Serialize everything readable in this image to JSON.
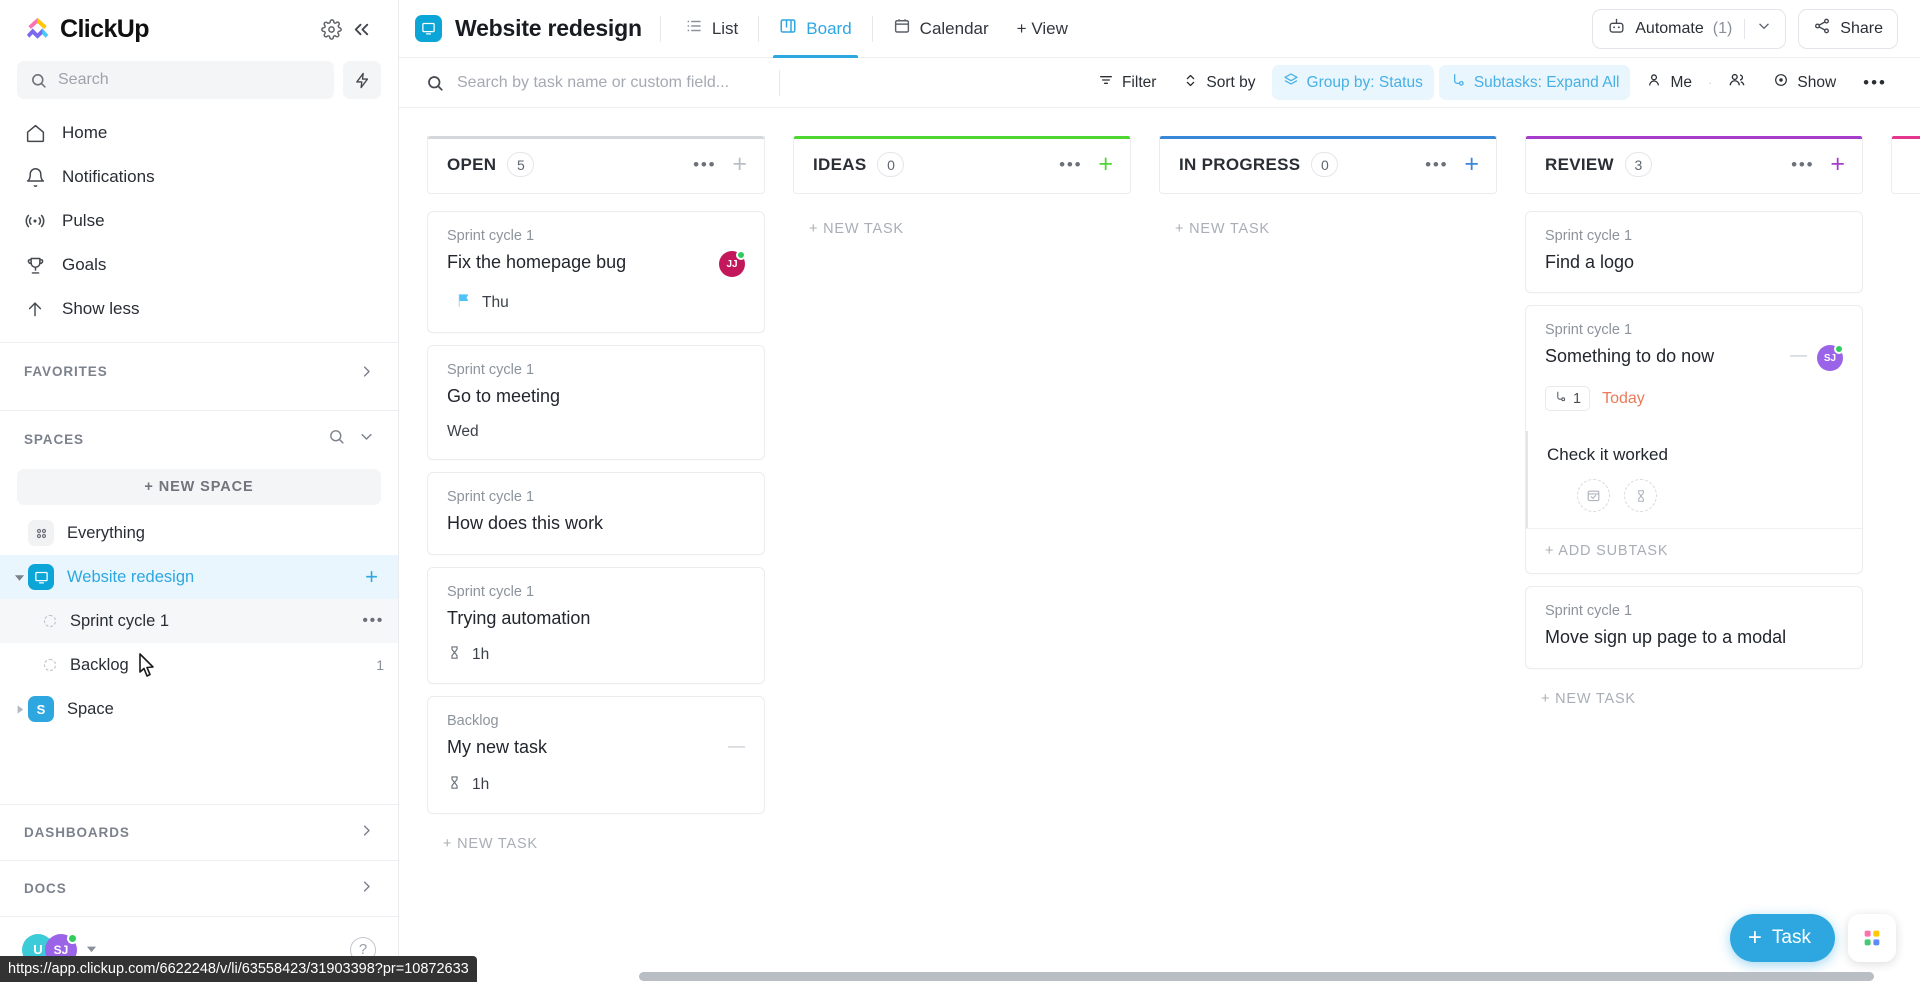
{
  "sidebar": {
    "brand": "ClickUp",
    "settings_icon": "gear-icon",
    "collapse_icon": "double-chevron-left-icon",
    "search": {
      "placeholder": "Search",
      "icon": "search-icon"
    },
    "bolt_icon": "lightning-bolt-icon",
    "nav": [
      {
        "label": "Home",
        "icon": "home-icon"
      },
      {
        "label": "Notifications",
        "icon": "bell-icon"
      },
      {
        "label": "Pulse",
        "icon": "pulse-icon"
      },
      {
        "label": "Goals",
        "icon": "trophy-icon"
      },
      {
        "label": "Show less",
        "icon": "arrow-up-icon"
      }
    ],
    "favorites": {
      "label": "FAVORITES",
      "chevron": "chevron-right-icon"
    },
    "spaces": {
      "label": "SPACES",
      "search_icon": "search-icon",
      "chevron": "chevron-down-icon"
    },
    "new_space": "+ NEW SPACE",
    "items": [
      {
        "label": "Everything",
        "type": "everything",
        "icon": "grid-dots-icon"
      },
      {
        "label": "Website redesign",
        "type": "space",
        "icon": "monitor-icon",
        "color": "#0ba5d8",
        "active": true,
        "plus": "+"
      },
      {
        "label": "Sprint cycle 1",
        "type": "list",
        "hovered": true,
        "dots": "•••"
      },
      {
        "label": "Backlog",
        "type": "list",
        "count": "1"
      },
      {
        "label": "Space",
        "type": "space",
        "icon": "S",
        "color": "#2ea7e0"
      }
    ],
    "dashboards": {
      "label": "DASHBOARDS",
      "chevron": "chevron-right-icon"
    },
    "docs": {
      "label": "DOCS",
      "chevron": "chevron-right-icon"
    },
    "footer": {
      "avatars": [
        {
          "initials": "U",
          "color": "#3ccbd9"
        },
        {
          "initials": "SJ",
          "color": "#9b63e8",
          "online": true
        }
      ],
      "chevron": "chevron-down-icon",
      "help_icon": "question-mark-icon"
    }
  },
  "header": {
    "project_icon": "monitor-icon",
    "project_color": "#0ba5d8",
    "title": "Website redesign",
    "views": [
      {
        "label": "List",
        "icon": "list-icon",
        "active": false
      },
      {
        "label": "Board",
        "icon": "board-icon",
        "active": true
      },
      {
        "label": "Calendar",
        "icon": "calendar-icon",
        "active": false
      }
    ],
    "add_view": "+ View",
    "automate": {
      "label": "Automate",
      "count": "(1)",
      "icon": "robot-icon",
      "chevron": "chevron-down-icon"
    },
    "share": {
      "label": "Share",
      "icon": "share-icon"
    }
  },
  "toolbar": {
    "search_placeholder": "Search by task name or custom field...",
    "search_icon": "search-icon",
    "filter": {
      "label": "Filter",
      "icon": "filter-icon"
    },
    "sort": {
      "label": "Sort by",
      "icon": "sort-icon"
    },
    "group": {
      "label": "Group by: Status",
      "icon": "layers-icon",
      "active": true
    },
    "subtasks": {
      "label": "Subtasks: Expand All",
      "icon": "subtask-icon",
      "active": true
    },
    "me": {
      "label": "Me",
      "icon": "person-icon"
    },
    "people_icon": "people-icon",
    "separator_dot": "·",
    "show": {
      "label": "Show",
      "icon": "eye-icon"
    },
    "more": "•••"
  },
  "board": {
    "columns": [
      {
        "name": "OPEN",
        "count": "5",
        "accent": "#d4d7db",
        "plus_color": "#b9bec5",
        "dots": "•••",
        "plus": "+",
        "new_task": "+ NEW TASK",
        "cards": [
          {
            "list": "Sprint cycle 1",
            "title": "Fix the homepage bug",
            "flag": {
              "icon": "flag-icon",
              "color": "#4fc3f7",
              "text": "Thu"
            },
            "avatar": {
              "initials": "JJ",
              "color": "#c2185b",
              "online": true
            }
          },
          {
            "list": "Sprint cycle 1",
            "title": "Go to meeting",
            "date_plain": "Wed"
          },
          {
            "list": "Sprint cycle 1",
            "title": "How does this work"
          },
          {
            "list": "Sprint cycle 1",
            "title": "Trying automation",
            "time": {
              "icon": "hourglass-icon",
              "text": "1h"
            }
          },
          {
            "list": "Backlog",
            "title": "My new task",
            "dash": "—",
            "time": {
              "icon": "hourglass-icon",
              "text": "1h"
            }
          }
        ]
      },
      {
        "name": "IDEAS",
        "count": "0",
        "accent": "#4ed633",
        "plus_color": "#4ed633",
        "dots": "•••",
        "plus": "+",
        "new_task": "+ NEW TASK",
        "cards": []
      },
      {
        "name": "IN PROGRESS",
        "count": "0",
        "accent": "#3a86d8",
        "plus_color": "#3a86d8",
        "dots": "•••",
        "plus": "+",
        "new_task": "+ NEW TASK",
        "cards": []
      },
      {
        "name": "REVIEW",
        "count": "3",
        "accent": "#a63ecb",
        "plus_color": "#a63ecb",
        "dots": "•••",
        "plus": "+",
        "new_task": "+ NEW TASK",
        "cards": [
          {
            "list": "Sprint cycle 1",
            "title": "Find a logo"
          },
          {
            "list": "Sprint cycle 1",
            "title": "Something to do now",
            "dash": "—",
            "avatar": {
              "initials": "SJ",
              "color": "#9b63e8",
              "online": true
            },
            "subtask_badge": {
              "icon": "subtask-icon",
              "count": "1"
            },
            "due": "Today",
            "subtask": {
              "title": "Check it worked",
              "actions": [
                {
                  "icon": "calendar-check-icon"
                },
                {
                  "icon": "hourglass-icon"
                }
              ],
              "add_label": "+ ADD SUBTASK"
            }
          },
          {
            "list": "Sprint cycle 1",
            "title": "Move sign up page to a modal"
          }
        ]
      },
      {
        "name": "",
        "count": "",
        "accent": "#e4358f",
        "plus_color": "#e4358f",
        "dots": "",
        "plus": "",
        "new_task": "",
        "cards": []
      }
    ]
  },
  "floating": {
    "task_button": {
      "label": "Task",
      "plus": "+"
    },
    "grid_icon": "apps-grid-icon"
  },
  "status_bar": {
    "url": "https://app.clickup.com/6622248/v/li/63558423/31903398?pr=10872633"
  }
}
